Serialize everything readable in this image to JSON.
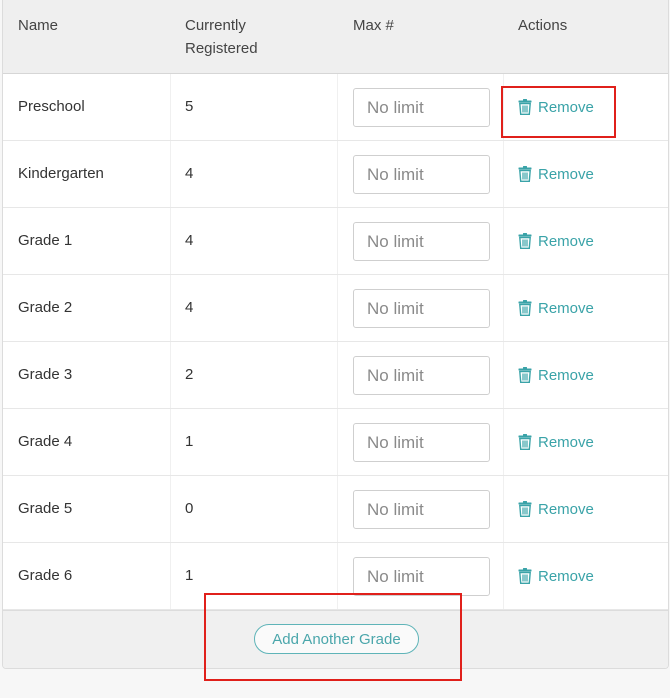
{
  "table": {
    "columns": {
      "name": "Name",
      "registered": "Currently Registered",
      "max": "Max #",
      "actions": "Actions"
    },
    "rows": [
      {
        "name": "Preschool",
        "registered": "5",
        "max_placeholder": "No limit",
        "action": "Remove"
      },
      {
        "name": "Kindergarten",
        "registered": "4",
        "max_placeholder": "No limit",
        "action": "Remove"
      },
      {
        "name": "Grade 1",
        "registered": "4",
        "max_placeholder": "No limit",
        "action": "Remove"
      },
      {
        "name": "Grade 2",
        "registered": "4",
        "max_placeholder": "No limit",
        "action": "Remove"
      },
      {
        "name": "Grade 3",
        "registered": "2",
        "max_placeholder": "No limit",
        "action": "Remove"
      },
      {
        "name": "Grade 4",
        "registered": "1",
        "max_placeholder": "No limit",
        "action": "Remove"
      },
      {
        "name": "Grade 5",
        "registered": "0",
        "max_placeholder": "No limit",
        "action": "Remove"
      },
      {
        "name": "Grade 6",
        "registered": "1",
        "max_placeholder": "No limit",
        "action": "Remove"
      }
    ]
  },
  "footer": {
    "add_label": "Add Another Grade"
  },
  "icons": {
    "remove": "trash-icon"
  },
  "colors": {
    "accent": "#3aa3a8",
    "highlight": "#e0201b"
  }
}
